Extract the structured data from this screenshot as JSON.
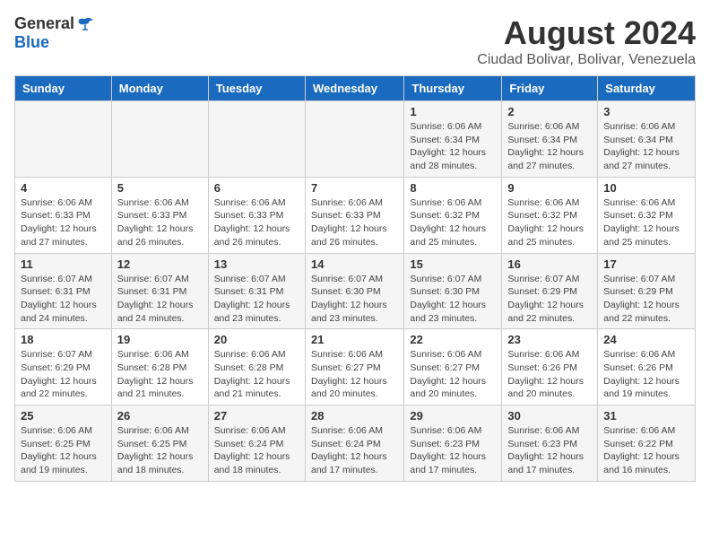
{
  "logo": {
    "general": "General",
    "blue": "Blue"
  },
  "title": "August 2024",
  "subtitle": "Ciudad Bolivar, Bolivar, Venezuela",
  "weekdays": [
    "Sunday",
    "Monday",
    "Tuesday",
    "Wednesday",
    "Thursday",
    "Friday",
    "Saturday"
  ],
  "weeks": [
    [
      {
        "day": "",
        "info": ""
      },
      {
        "day": "",
        "info": ""
      },
      {
        "day": "",
        "info": ""
      },
      {
        "day": "",
        "info": ""
      },
      {
        "day": "1",
        "info": "Sunrise: 6:06 AM\nSunset: 6:34 PM\nDaylight: 12 hours\nand 28 minutes."
      },
      {
        "day": "2",
        "info": "Sunrise: 6:06 AM\nSunset: 6:34 PM\nDaylight: 12 hours\nand 27 minutes."
      },
      {
        "day": "3",
        "info": "Sunrise: 6:06 AM\nSunset: 6:34 PM\nDaylight: 12 hours\nand 27 minutes."
      }
    ],
    [
      {
        "day": "4",
        "info": "Sunrise: 6:06 AM\nSunset: 6:33 PM\nDaylight: 12 hours\nand 27 minutes."
      },
      {
        "day": "5",
        "info": "Sunrise: 6:06 AM\nSunset: 6:33 PM\nDaylight: 12 hours\nand 26 minutes."
      },
      {
        "day": "6",
        "info": "Sunrise: 6:06 AM\nSunset: 6:33 PM\nDaylight: 12 hours\nand 26 minutes."
      },
      {
        "day": "7",
        "info": "Sunrise: 6:06 AM\nSunset: 6:33 PM\nDaylight: 12 hours\nand 26 minutes."
      },
      {
        "day": "8",
        "info": "Sunrise: 6:06 AM\nSunset: 6:32 PM\nDaylight: 12 hours\nand 25 minutes."
      },
      {
        "day": "9",
        "info": "Sunrise: 6:06 AM\nSunset: 6:32 PM\nDaylight: 12 hours\nand 25 minutes."
      },
      {
        "day": "10",
        "info": "Sunrise: 6:06 AM\nSunset: 6:32 PM\nDaylight: 12 hours\nand 25 minutes."
      }
    ],
    [
      {
        "day": "11",
        "info": "Sunrise: 6:07 AM\nSunset: 6:31 PM\nDaylight: 12 hours\nand 24 minutes."
      },
      {
        "day": "12",
        "info": "Sunrise: 6:07 AM\nSunset: 6:31 PM\nDaylight: 12 hours\nand 24 minutes."
      },
      {
        "day": "13",
        "info": "Sunrise: 6:07 AM\nSunset: 6:31 PM\nDaylight: 12 hours\nand 23 minutes."
      },
      {
        "day": "14",
        "info": "Sunrise: 6:07 AM\nSunset: 6:30 PM\nDaylight: 12 hours\nand 23 minutes."
      },
      {
        "day": "15",
        "info": "Sunrise: 6:07 AM\nSunset: 6:30 PM\nDaylight: 12 hours\nand 23 minutes."
      },
      {
        "day": "16",
        "info": "Sunrise: 6:07 AM\nSunset: 6:29 PM\nDaylight: 12 hours\nand 22 minutes."
      },
      {
        "day": "17",
        "info": "Sunrise: 6:07 AM\nSunset: 6:29 PM\nDaylight: 12 hours\nand 22 minutes."
      }
    ],
    [
      {
        "day": "18",
        "info": "Sunrise: 6:07 AM\nSunset: 6:29 PM\nDaylight: 12 hours\nand 22 minutes."
      },
      {
        "day": "19",
        "info": "Sunrise: 6:06 AM\nSunset: 6:28 PM\nDaylight: 12 hours\nand 21 minutes."
      },
      {
        "day": "20",
        "info": "Sunrise: 6:06 AM\nSunset: 6:28 PM\nDaylight: 12 hours\nand 21 minutes."
      },
      {
        "day": "21",
        "info": "Sunrise: 6:06 AM\nSunset: 6:27 PM\nDaylight: 12 hours\nand 20 minutes."
      },
      {
        "day": "22",
        "info": "Sunrise: 6:06 AM\nSunset: 6:27 PM\nDaylight: 12 hours\nand 20 minutes."
      },
      {
        "day": "23",
        "info": "Sunrise: 6:06 AM\nSunset: 6:26 PM\nDaylight: 12 hours\nand 20 minutes."
      },
      {
        "day": "24",
        "info": "Sunrise: 6:06 AM\nSunset: 6:26 PM\nDaylight: 12 hours\nand 19 minutes."
      }
    ],
    [
      {
        "day": "25",
        "info": "Sunrise: 6:06 AM\nSunset: 6:25 PM\nDaylight: 12 hours\nand 19 minutes."
      },
      {
        "day": "26",
        "info": "Sunrise: 6:06 AM\nSunset: 6:25 PM\nDaylight: 12 hours\nand 18 minutes."
      },
      {
        "day": "27",
        "info": "Sunrise: 6:06 AM\nSunset: 6:24 PM\nDaylight: 12 hours\nand 18 minutes."
      },
      {
        "day": "28",
        "info": "Sunrise: 6:06 AM\nSunset: 6:24 PM\nDaylight: 12 hours\nand 17 minutes."
      },
      {
        "day": "29",
        "info": "Sunrise: 6:06 AM\nSunset: 6:23 PM\nDaylight: 12 hours\nand 17 minutes."
      },
      {
        "day": "30",
        "info": "Sunrise: 6:06 AM\nSunset: 6:23 PM\nDaylight: 12 hours\nand 17 minutes."
      },
      {
        "day": "31",
        "info": "Sunrise: 6:06 AM\nSunset: 6:22 PM\nDaylight: 12 hours\nand 16 minutes."
      }
    ]
  ]
}
